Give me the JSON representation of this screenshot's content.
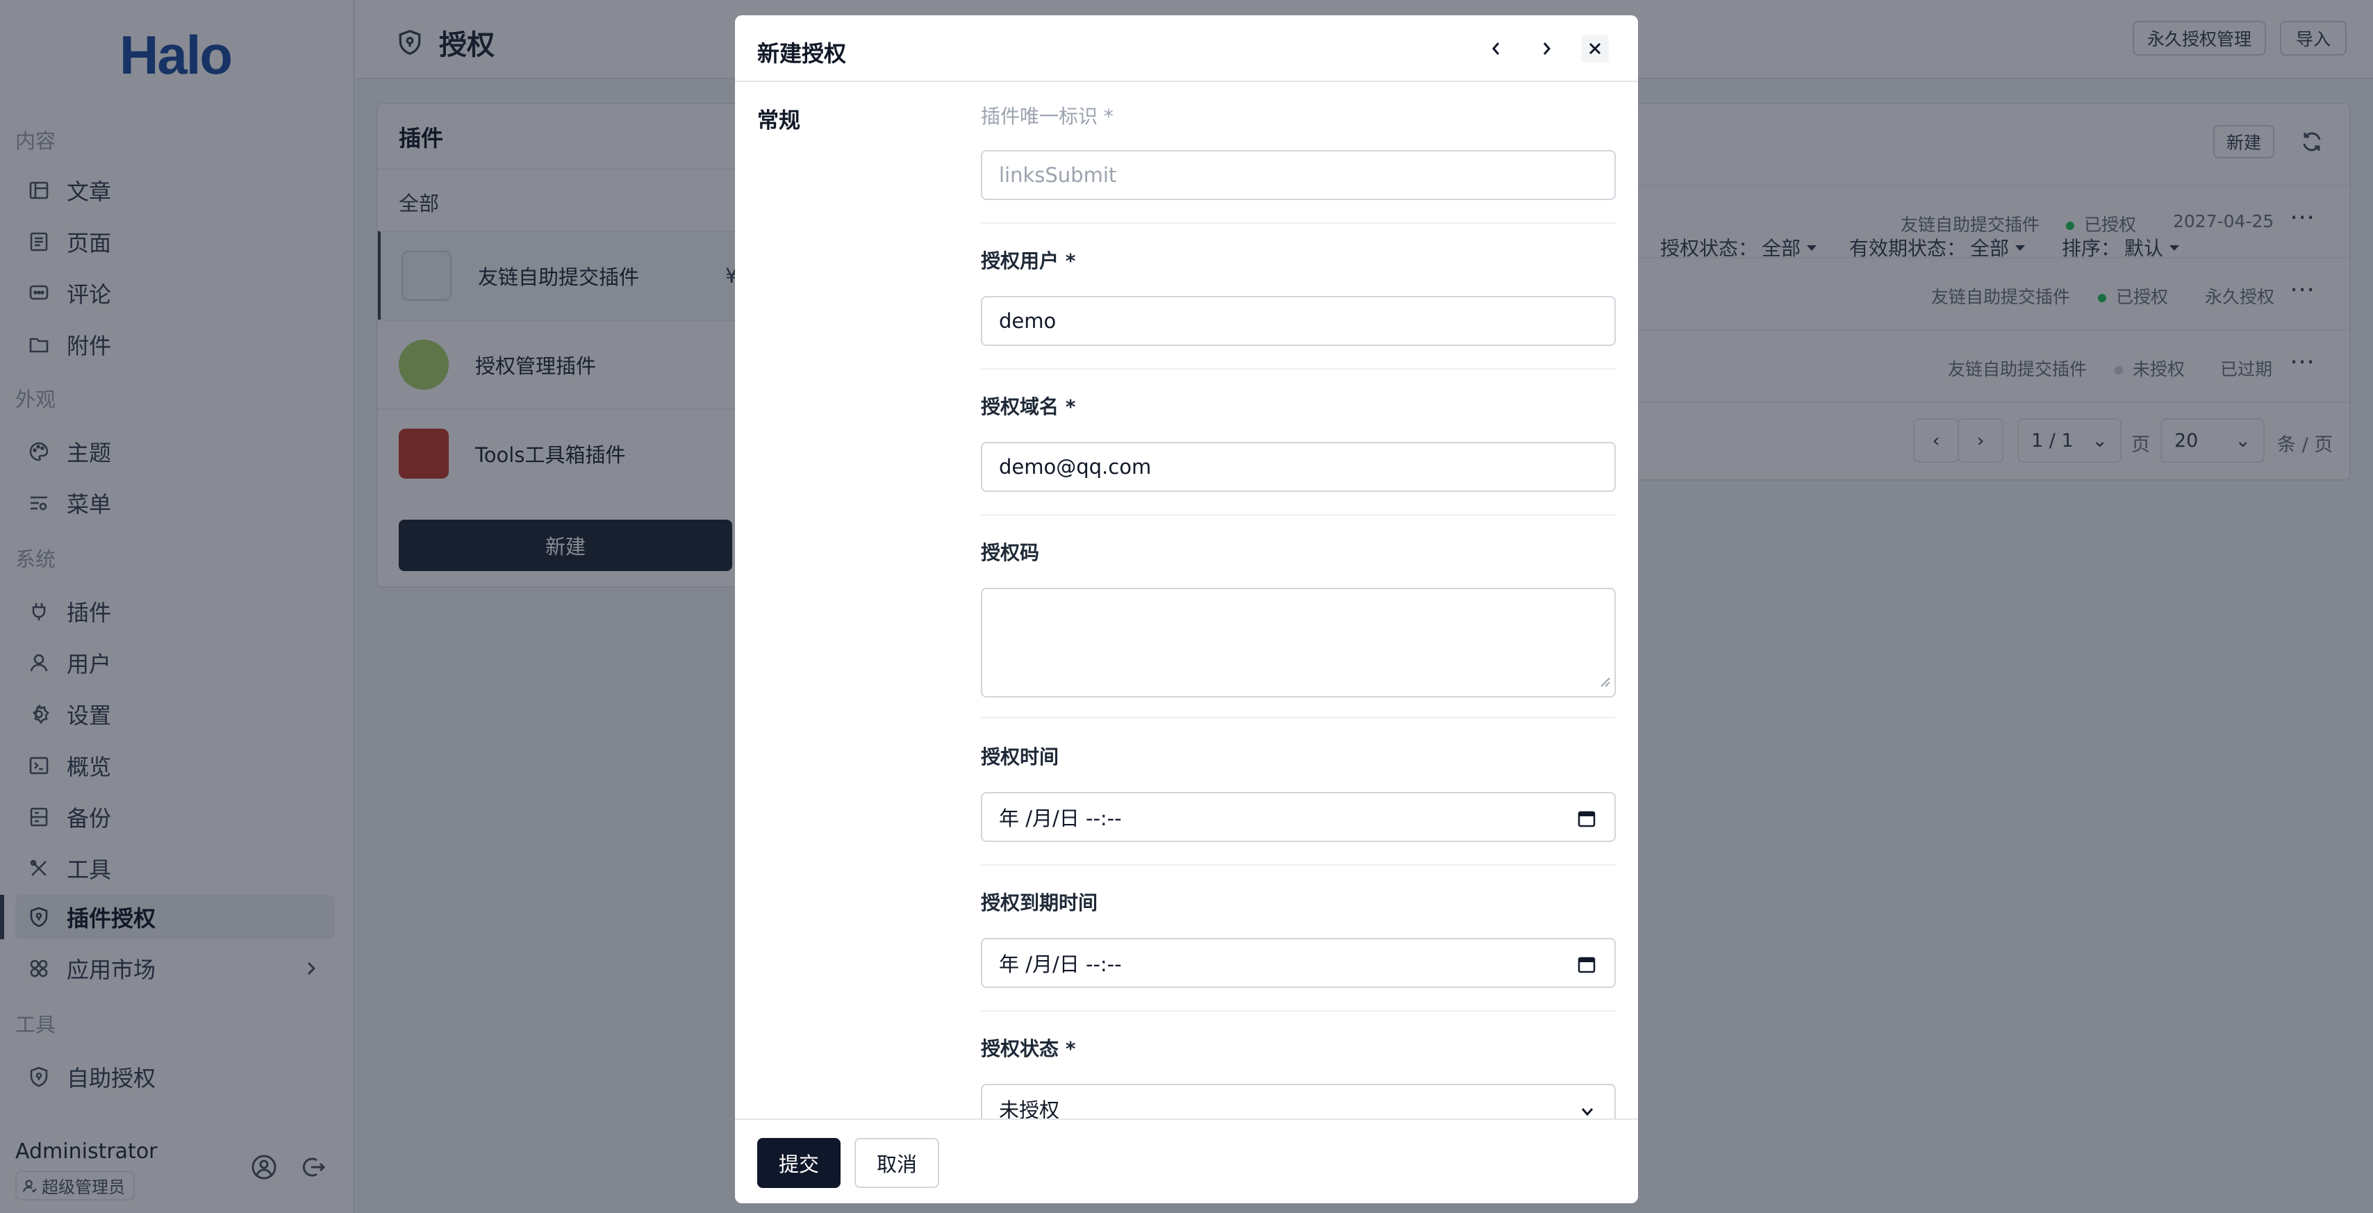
{
  "app": {
    "logo": "Halo"
  },
  "sidebar": {
    "sections": [
      {
        "title": "内容",
        "items": [
          {
            "label": "文章",
            "icon": "book-icon"
          },
          {
            "label": "页面",
            "icon": "page-icon"
          },
          {
            "label": "评论",
            "icon": "comment-icon"
          },
          {
            "label": "附件",
            "icon": "folder-icon"
          }
        ]
      },
      {
        "title": "外观",
        "items": [
          {
            "label": "主题",
            "icon": "palette-icon"
          },
          {
            "label": "菜单",
            "icon": "menu-icon"
          }
        ]
      },
      {
        "title": "系统",
        "items": [
          {
            "label": "插件",
            "icon": "plug-icon"
          },
          {
            "label": "用户",
            "icon": "user-icon"
          },
          {
            "label": "设置",
            "icon": "gear-icon"
          },
          {
            "label": "概览",
            "icon": "terminal-icon"
          },
          {
            "label": "备份",
            "icon": "backup-icon"
          },
          {
            "label": "工具",
            "icon": "tools-icon"
          },
          {
            "label": "插件授权",
            "icon": "shield-icon",
            "active": true
          },
          {
            "label": "应用市场",
            "icon": "apps-icon"
          }
        ]
      },
      {
        "title": "工具",
        "items": [
          {
            "label": "自助授权",
            "icon": "shield-icon"
          }
        ]
      }
    ],
    "user": {
      "name": "Administrator",
      "role": "超级管理员"
    }
  },
  "header": {
    "title": "授权",
    "buttons": [
      "永久授权管理",
      "导入"
    ]
  },
  "plugin_panel": {
    "title": "插件",
    "filter_all": "全部",
    "plugins": [
      {
        "name": "友链自助提交插件",
        "price": "¥"
      },
      {
        "name": "授权管理插件"
      },
      {
        "name": "Tools工具箱插件"
      }
    ],
    "new_button": "新建"
  },
  "list_panel": {
    "filters": [
      {
        "label": "授权状态：",
        "value": "全部"
      },
      {
        "label": "有效期状态：",
        "value": "全部"
      },
      {
        "label": "排序：",
        "value": "默认"
      }
    ],
    "new_button": "新建",
    "rows": [
      {
        "plugin": "友链自助提交插件",
        "status": "已授权",
        "status_color": "#22c55e",
        "expiry": "2027-04-25"
      },
      {
        "plugin": "友链自助提交插件",
        "status": "已授权",
        "status_color": "#22c55e",
        "expiry": "永久授权"
      },
      {
        "plugin": "友链自助提交插件",
        "status": "未授权",
        "status_color": "#d1d5db",
        "expiry": "已过期"
      }
    ],
    "pagination": {
      "page": "1 / 1",
      "page_suffix": "页",
      "size": "20",
      "size_suffix": "条 / 页"
    }
  },
  "modal": {
    "title": "新建授权",
    "section": "常规",
    "fields": {
      "plugin_id": {
        "label": "插件唯一标识 *",
        "value": "linksSubmit"
      },
      "user": {
        "label": "授权用户 *",
        "value": "demo"
      },
      "domain": {
        "label": "授权域名 *",
        "value": "demo@qq.com"
      },
      "code": {
        "label": "授权码",
        "value": ""
      },
      "time": {
        "label": "授权时间",
        "value": "年 /月/日 --:--"
      },
      "expire_time": {
        "label": "授权到期时间",
        "value": "年 /月/日 --:--"
      },
      "status": {
        "label": "授权状态 *",
        "value": "未授权"
      }
    },
    "submit": "提交",
    "cancel": "取消"
  }
}
